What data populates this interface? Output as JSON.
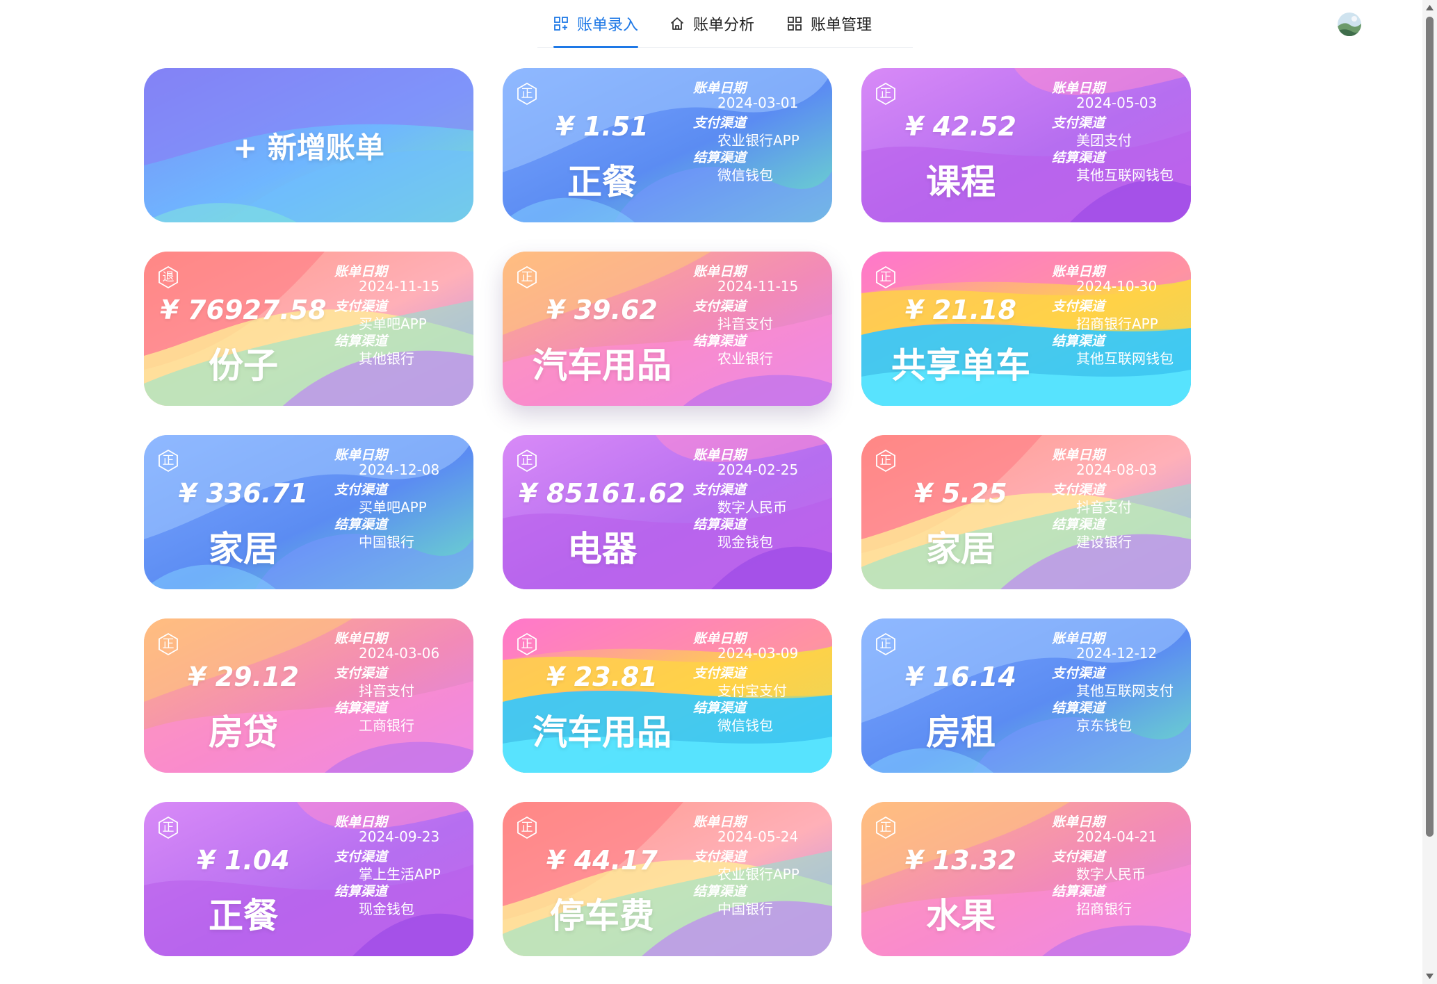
{
  "nav": {
    "tabs": [
      {
        "label": "账单录入",
        "icon": "entry-grid-icon",
        "active": true
      },
      {
        "label": "账单分析",
        "icon": "home-icon",
        "active": false
      },
      {
        "label": "账单管理",
        "icon": "grid-icon",
        "active": false
      }
    ],
    "accent": "#1e78e6"
  },
  "add_card": {
    "label": "+ 新增账单"
  },
  "field_labels": {
    "date": "账单日期",
    "pay_channel": "支付渠道",
    "settle_channel": "结算渠道"
  },
  "currency_symbol": "¥",
  "bills": [
    {
      "badge": "正",
      "amount": "¥ 1.51",
      "category": "正餐",
      "date": "2024-03-01",
      "pay_channel": "农业银行APP",
      "settle_channel": "微信钱包",
      "theme": "blue"
    },
    {
      "badge": "正",
      "amount": "¥ 42.52",
      "category": "课程",
      "date": "2024-05-03",
      "pay_channel": "美团支付",
      "settle_channel": "其他互联网钱包",
      "theme": "purple"
    },
    {
      "badge": "退",
      "amount": "¥ 76927.58",
      "category": "份子",
      "date": "2024-11-15",
      "pay_channel": "买单吧APP",
      "settle_channel": "其他银行",
      "theme": "rainbow"
    },
    {
      "badge": "正",
      "amount": "¥ 39.62",
      "category": "汽车用品",
      "date": "2024-11-15",
      "pay_channel": "抖音支付",
      "settle_channel": "农业银行",
      "theme": "peach"
    },
    {
      "badge": "正",
      "amount": "¥ 21.18",
      "category": "共享单车",
      "date": "2024-10-30",
      "pay_channel": "招商银行APP",
      "settle_channel": "其他互联网钱包",
      "theme": "cyan"
    },
    {
      "badge": "正",
      "amount": "¥ 336.71",
      "category": "家居",
      "date": "2024-12-08",
      "pay_channel": "买单吧APP",
      "settle_channel": "中国银行",
      "theme": "blue"
    },
    {
      "badge": "正",
      "amount": "¥ 85161.62",
      "category": "电器",
      "date": "2024-02-25",
      "pay_channel": "数字人民币",
      "settle_channel": "现金钱包",
      "theme": "purple"
    },
    {
      "badge": "正",
      "amount": "¥ 5.25",
      "category": "家居",
      "date": "2024-08-03",
      "pay_channel": "抖音支付",
      "settle_channel": "建设银行",
      "theme": "rainbow"
    },
    {
      "badge": "正",
      "amount": "¥ 29.12",
      "category": "房贷",
      "date": "2024-03-06",
      "pay_channel": "抖音支付",
      "settle_channel": "工商银行",
      "theme": "peach"
    },
    {
      "badge": "正",
      "amount": "¥ 23.81",
      "category": "汽车用品",
      "date": "2024-03-09",
      "pay_channel": "支付宝支付",
      "settle_channel": "微信钱包",
      "theme": "cyan"
    },
    {
      "badge": "正",
      "amount": "¥ 16.14",
      "category": "房租",
      "date": "2024-12-12",
      "pay_channel": "其他互联网支付",
      "settle_channel": "京东钱包",
      "theme": "blue"
    },
    {
      "badge": "正",
      "amount": "¥ 1.04",
      "category": "正餐",
      "date": "2024-09-23",
      "pay_channel": "掌上生活APP",
      "settle_channel": "现金钱包",
      "theme": "purple"
    },
    {
      "badge": "正",
      "amount": "¥ 44.17",
      "category": "停车费",
      "date": "2024-05-24",
      "pay_channel": "农业银行APP",
      "settle_channel": "中国银行",
      "theme": "rainbow"
    },
    {
      "badge": "正",
      "amount": "¥ 13.32",
      "category": "水果",
      "date": "2024-04-21",
      "pay_channel": "数字人民币",
      "settle_channel": "招商银行",
      "theme": "peach"
    }
  ]
}
